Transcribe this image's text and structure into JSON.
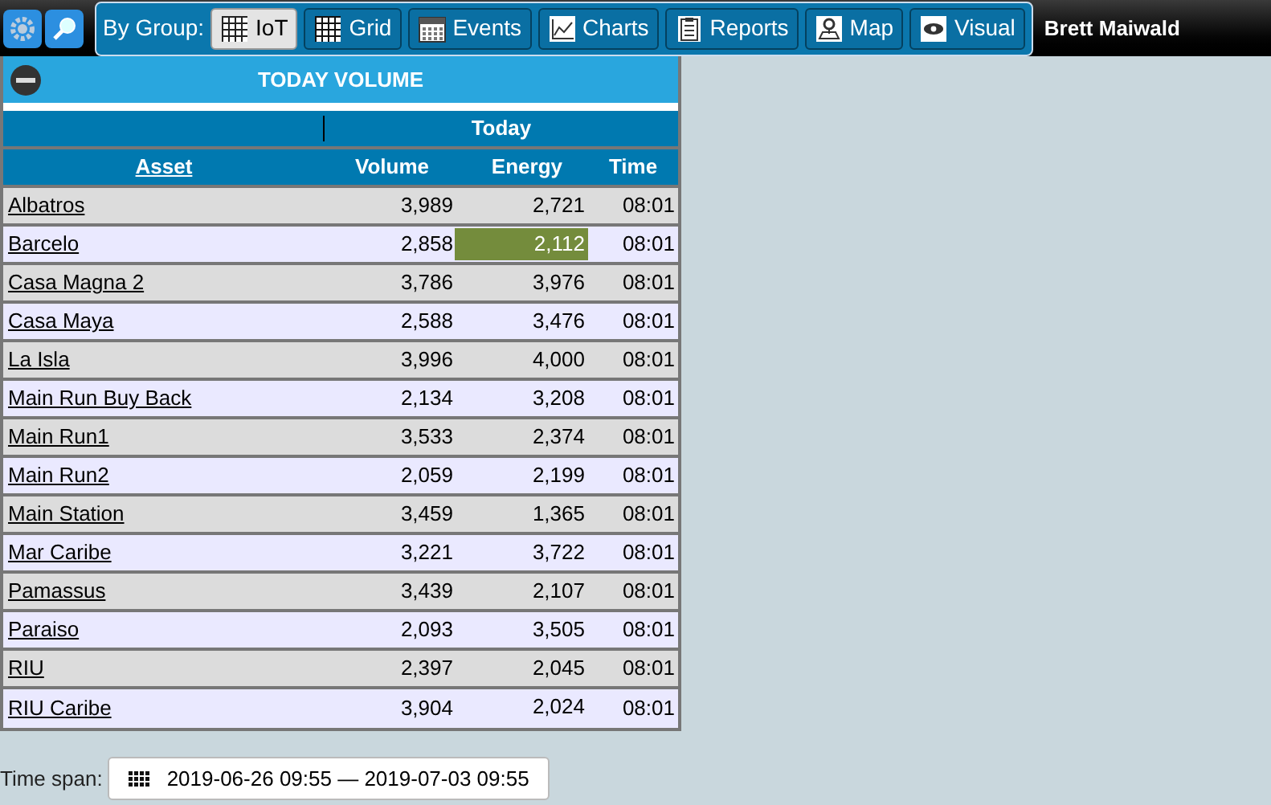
{
  "toolbar": {
    "group_label": "By Group:",
    "buttons": [
      {
        "label": "IoT",
        "kind": "iot",
        "selected": true
      },
      {
        "label": "Grid",
        "kind": "grid",
        "selected": false
      },
      {
        "label": "Events",
        "kind": "calendar",
        "selected": false
      },
      {
        "label": "Charts",
        "kind": "chart",
        "selected": false
      },
      {
        "label": "Reports",
        "kind": "clipboard",
        "selected": false
      },
      {
        "label": "Map",
        "kind": "map",
        "selected": false
      },
      {
        "label": "Visual",
        "kind": "eye",
        "selected": false
      }
    ]
  },
  "user": "Brett Maiwald",
  "panel": {
    "title": "TODAY VOLUME",
    "group_header": "Today",
    "columns": [
      "Asset",
      "Volume",
      "Energy",
      "Time"
    ],
    "rows": [
      {
        "asset": "Albatros",
        "volume": "3,989",
        "energy": "2,721",
        "time": "08:01",
        "energy_highlight": false
      },
      {
        "asset": "Barcelo",
        "volume": "2,858",
        "energy": "2,112",
        "time": "08:01",
        "energy_highlight": true
      },
      {
        "asset": "Casa Magna 2",
        "volume": "3,786",
        "energy": "3,976",
        "time": "08:01",
        "energy_highlight": false
      },
      {
        "asset": "Casa Maya",
        "volume": "2,588",
        "energy": "3,476",
        "time": "08:01",
        "energy_highlight": false
      },
      {
        "asset": "La Isla",
        "volume": "3,996",
        "energy": "4,000",
        "time": "08:01",
        "energy_highlight": false
      },
      {
        "asset": "Main Run Buy Back",
        "volume": "2,134",
        "energy": "3,208",
        "time": "08:01",
        "energy_highlight": false
      },
      {
        "asset": "Main Run1",
        "volume": "3,533",
        "energy": "2,374",
        "time": "08:01",
        "energy_highlight": false
      },
      {
        "asset": "Main Run2",
        "volume": "2,059",
        "energy": "2,199",
        "time": "08:01",
        "energy_highlight": false
      },
      {
        "asset": "Main Station",
        "volume": "3,459",
        "energy": "1,365",
        "time": "08:01",
        "energy_highlight": false
      },
      {
        "asset": "Mar Caribe",
        "volume": "3,221",
        "energy": "3,722",
        "time": "08:01",
        "energy_highlight": false
      },
      {
        "asset": "Pamassus",
        "volume": "3,439",
        "energy": "2,107",
        "time": "08:01",
        "energy_highlight": false
      },
      {
        "asset": "Paraiso",
        "volume": "2,093",
        "energy": "3,505",
        "time": "08:01",
        "energy_highlight": false
      },
      {
        "asset": "RIU",
        "volume": "2,397",
        "energy": "2,045",
        "time": "08:01",
        "energy_highlight": false
      },
      {
        "asset": "RIU Caribe",
        "volume": "3,904",
        "energy": "2,024",
        "time": "08:01",
        "energy_highlight": false
      }
    ]
  },
  "time_span": {
    "label": "Time span:",
    "value": "2019-06-26 09:55 — 2019-07-03 09:55"
  }
}
